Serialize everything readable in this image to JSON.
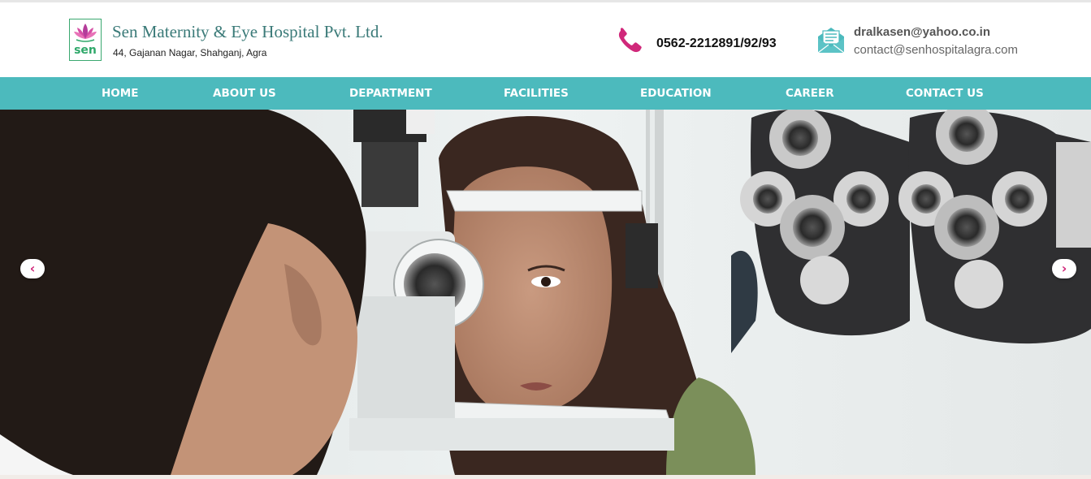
{
  "header": {
    "brand_name": "Sen Maternity & Eye Hospital Pvt. Ltd.",
    "address": "44, Gajanan Nagar, Shahganj, Agra",
    "logo_text": "sen",
    "phone": "0562-2212891/92/93",
    "email_primary": "dralkasen@yahoo.co.in",
    "email_secondary": "contact@senhospitalagra.com"
  },
  "nav": {
    "items": [
      {
        "label": "HOME"
      },
      {
        "label": "ABOUT US"
      },
      {
        "label": "DEPARTMENT"
      },
      {
        "label": "FACILITIES"
      },
      {
        "label": "EDUCATION"
      },
      {
        "label": "CAREER"
      },
      {
        "label": "CONTACT US"
      }
    ]
  },
  "slider": {
    "prev_icon": "chevron-left-icon",
    "next_icon": "chevron-right-icon",
    "prev_glyph": "‹",
    "next_glyph": "›"
  },
  "colors": {
    "nav_bg": "#4cbabd",
    "brand_text": "#3a7a78",
    "accent_pink": "#d0287a",
    "logo_green": "#2fa86a",
    "icon_teal": "#4cbabd"
  }
}
